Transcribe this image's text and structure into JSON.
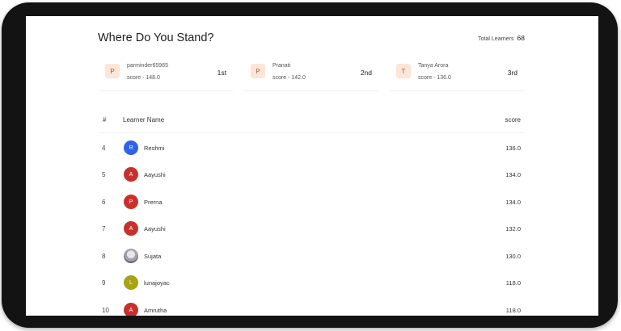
{
  "page": {
    "title": "Where Do You Stand?",
    "total_label": "Total Learners",
    "total_value": "68"
  },
  "top_three": [
    {
      "initial": "P",
      "name": "parminder65965",
      "score": "score - 148.0",
      "rank": "1st"
    },
    {
      "initial": "P",
      "name": "Pranati",
      "score": "score - 142.0",
      "rank": "2nd"
    },
    {
      "initial": "T",
      "name": "Tanya Arora",
      "score": "score - 136.0",
      "rank": "3rd"
    }
  ],
  "table": {
    "headers": {
      "rank": "#",
      "name": "Learner Name",
      "score": "score"
    },
    "rows": [
      {
        "rank": "4",
        "initial": "R",
        "name": "Reshmi",
        "score": "136.0",
        "avatar_color": "#2f64e8"
      },
      {
        "rank": "5",
        "initial": "A",
        "name": "Aayushi",
        "score": "134.0",
        "avatar_color": "#c7312d"
      },
      {
        "rank": "6",
        "initial": "P",
        "name": "Prerna",
        "score": "134.0",
        "avatar_color": "#c7312d"
      },
      {
        "rank": "7",
        "initial": "A",
        "name": "Aayushi",
        "score": "132.0",
        "avatar_color": "#c7312d"
      },
      {
        "rank": "8",
        "initial": "",
        "name": "Sujata",
        "score": "130.0",
        "avatar_color": "#8a8a94"
      },
      {
        "rank": "9",
        "initial": "L",
        "name": "lunajoyac",
        "score": "118.0",
        "avatar_color": "#a7a313"
      },
      {
        "rank": "10",
        "initial": "A",
        "name": "Amrutha",
        "score": "118.0",
        "avatar_color": "#c7312d"
      }
    ]
  }
}
